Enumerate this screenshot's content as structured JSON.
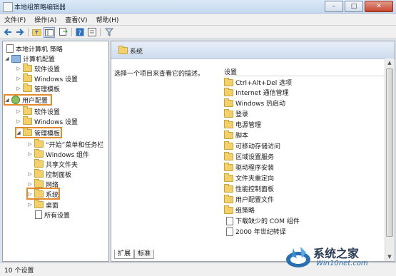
{
  "window": {
    "title": "本地组策略编辑器",
    "buttons": [
      "–",
      "□",
      "✕"
    ]
  },
  "menubar": {
    "items": [
      "文件(F)",
      "操作(A)",
      "查看(V)",
      "帮助(H)"
    ]
  },
  "toolbar": {
    "icons": [
      "back-arrow-icon",
      "forward-arrow-icon",
      "up-folder-icon",
      "show-hide-tree-icon",
      "export-list-icon",
      "help-icon",
      "properties-icon",
      "filter-icon"
    ]
  },
  "tree": {
    "items": [
      {
        "label": "本地计算机 策略"
      },
      {
        "label": "计算机配置"
      },
      {
        "label": "软件设置"
      },
      {
        "label": "Windows 设置"
      },
      {
        "label": "管理模板"
      },
      {
        "label": "用户配置"
      },
      {
        "label": "软件设置"
      },
      {
        "label": "Windows 设置"
      },
      {
        "label": "管理模板"
      },
      {
        "label": "“开始”菜单和任务栏"
      },
      {
        "label": "Windows 组件"
      },
      {
        "label": "共享文件夹"
      },
      {
        "label": "控制面板"
      },
      {
        "label": "网络"
      },
      {
        "label": "系统"
      },
      {
        "label": "桌面"
      },
      {
        "label": "所有设置"
      }
    ]
  },
  "details": {
    "header": "系统",
    "description": "选择一个项目来查看它的描述。",
    "column_header": "设置",
    "items": [
      "Ctrl+Alt+Del 选项",
      "Internet 通信管理",
      "Windows 热启动",
      "登录",
      "电源管理",
      "脚本",
      "可移动存储访问",
      "区域设置服务",
      "驱动程序安装",
      "文件夹重定向",
      "性能控制面板",
      "用户配置文件",
      "组策略",
      "下载缺少的 COM 组件",
      "2000 年世纪转译"
    ],
    "tabs": [
      "扩展",
      "标准"
    ]
  },
  "status": {
    "text": "10 个设置"
  },
  "watermark": {
    "line1": "系统之家",
    "line2": "Win10net.com"
  },
  "colors": {
    "highlight": "#e58a2c",
    "folder": "#f2d16c",
    "window_bg": "#d9e4f1"
  }
}
